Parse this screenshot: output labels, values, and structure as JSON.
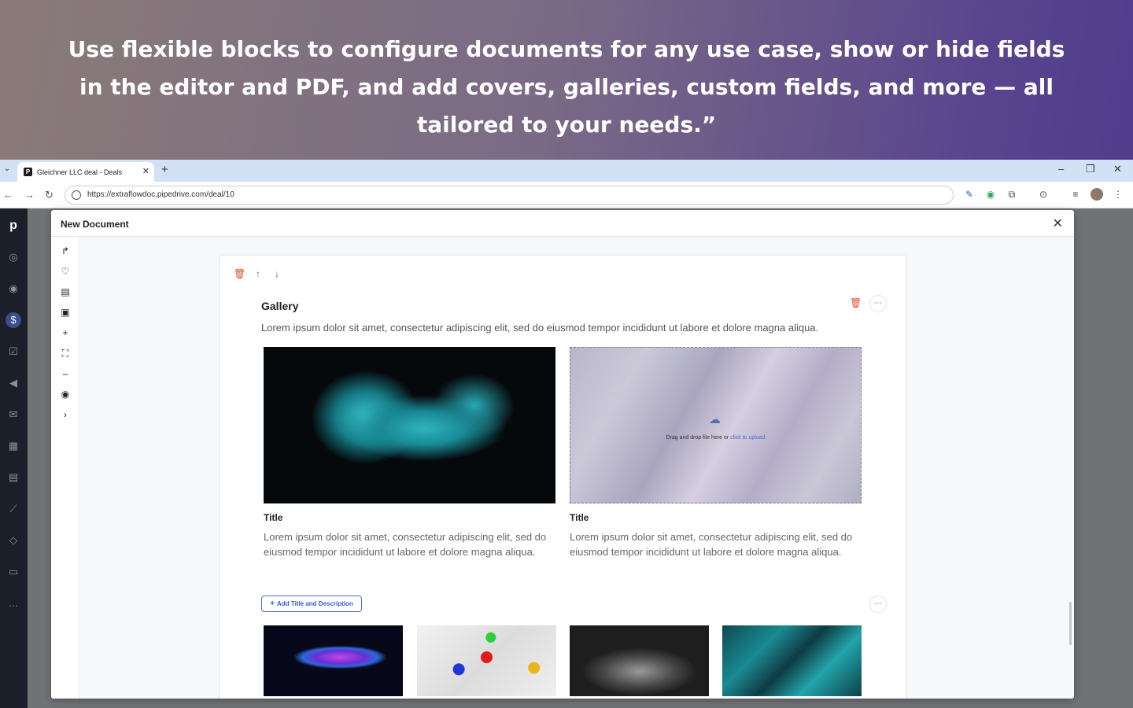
{
  "hero": {
    "text": "Use flexible blocks to configure documents for any use case, show or hide fields in the editor and PDF, and add covers, galleries, custom fields, and more — all tailored to your needs.”"
  },
  "browser": {
    "tab_title": "Gleichner LLC deal - Deals",
    "tab_favicon_letter": "P",
    "url": "https://extraflowdoc.pipedrive.com/deal/10"
  },
  "modal": {
    "title": "New Document"
  },
  "gallery": {
    "title": "Gallery",
    "description": "Lorem ipsum dolor sit amet, consectetur adipiscing elit, sed do eiusmod tempor incididunt ut labore et dolore magna aliqua.",
    "upload_text": "Drag and drop file here or ",
    "upload_link": "click to upload",
    "items": [
      {
        "title": "Title",
        "description": "Lorem ipsum dolor sit amet, consectetur adipiscing elit, sed do eiusmod tempor incididunt ut labore et dolore magna aliqua."
      },
      {
        "title": "Title",
        "description": "Lorem ipsum dolor sit amet, consectetur adipiscing elit, sed do eiusmod tempor incididunt ut labore et dolore magna aliqua."
      }
    ],
    "add_button_label": "Add Title and Description"
  },
  "colors": {
    "accent": "#4a6cd6",
    "danger": "#e0512e",
    "sidebar": "#1b2028"
  }
}
